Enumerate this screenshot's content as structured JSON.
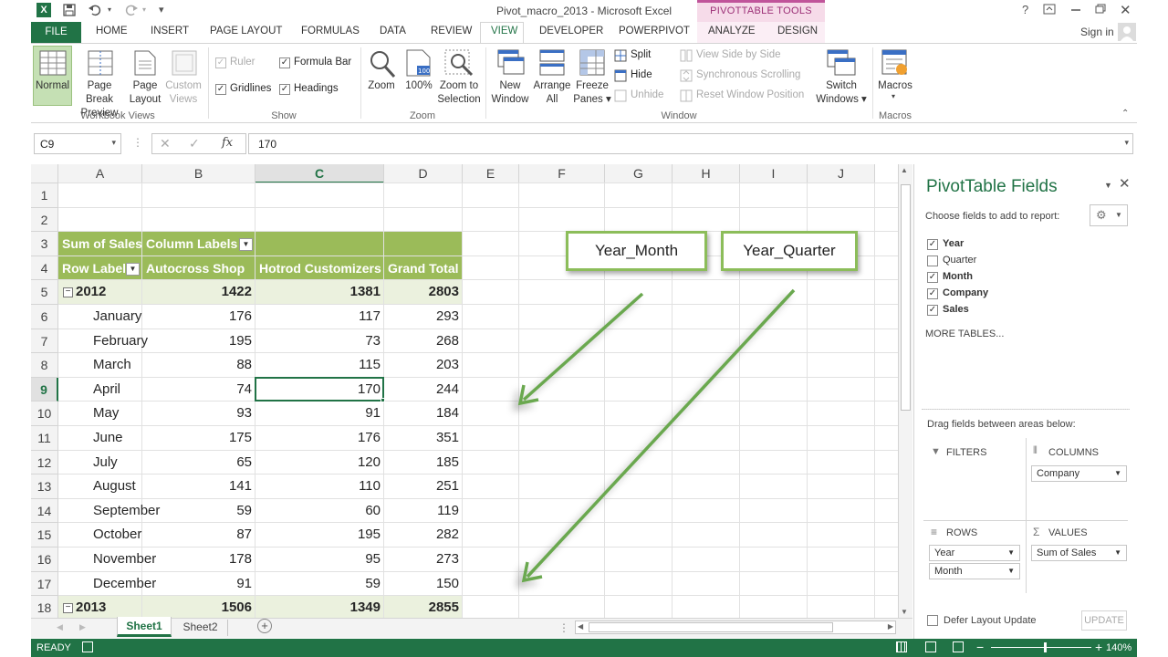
{
  "window": {
    "title": "Pivot_macro_2013 - Microsoft Excel",
    "context_tool": "PIVOTTABLE TOOLS",
    "sign_in": "Sign in",
    "help": "?",
    "buttons": [
      "restore-ribbon-icon",
      "minimize-icon",
      "maximize-icon",
      "close-icon"
    ]
  },
  "tabs": [
    "FILE",
    "HOME",
    "INSERT",
    "PAGE LAYOUT",
    "FORMULAS",
    "DATA",
    "REVIEW",
    "VIEW",
    "DEVELOPER",
    "POWERPIVOT",
    "ANALYZE",
    "DESIGN"
  ],
  "active_tab": "VIEW",
  "ribbon": {
    "workbook_views": {
      "group": "Workbook Views",
      "normal": "Normal",
      "page_break": [
        "Page Break",
        "Preview"
      ],
      "page_layout": [
        "Page",
        "Layout"
      ],
      "custom": [
        "Custom",
        "Views"
      ]
    },
    "show": {
      "group": "Show",
      "ruler": "Ruler",
      "formula_bar": "Formula Bar",
      "gridlines": "Gridlines",
      "headings": "Headings"
    },
    "zoom": {
      "group": "Zoom",
      "zoom": "Zoom",
      "hundred": "100%",
      "zoom_sel": [
        "Zoom to",
        "Selection"
      ]
    },
    "window": {
      "group": "Window",
      "new": [
        "New",
        "Window"
      ],
      "arrange": [
        "Arrange",
        "All"
      ],
      "freeze": [
        "Freeze",
        "Panes ▾"
      ],
      "split": "Split",
      "hide": "Hide",
      "unhide": "Unhide",
      "side": "View Side by Side",
      "sync": "Synchronous Scrolling",
      "reset": "Reset Window Position",
      "switch": [
        "Switch",
        "Windows ▾"
      ]
    },
    "macros": {
      "group": "Macros",
      "macros": "Macros"
    }
  },
  "formula_bar": {
    "name_box": "C9",
    "fx": "fx",
    "value": "170"
  },
  "columns": [
    "A",
    "B",
    "C",
    "D",
    "E",
    "F",
    "G",
    "H",
    "I",
    "J"
  ],
  "rows": [
    "1",
    "2",
    "3",
    "4",
    "5",
    "6",
    "7",
    "8",
    "9",
    "10",
    "11",
    "12",
    "13",
    "14",
    "15",
    "16",
    "17",
    "18"
  ],
  "pivot_table": {
    "header1_a": "Sum of Sales",
    "header1_b": "Column Labels",
    "header2": [
      "Row Labels",
      "Autocross Shop",
      "Hotrod Customizers",
      "Grand Total"
    ],
    "year_rows": [
      {
        "label": "2012",
        "values": [
          "1422",
          "1381",
          "2803"
        ]
      },
      {
        "label": "2013",
        "values": [
          "1506",
          "1349",
          "2855"
        ]
      }
    ],
    "months": [
      {
        "label": "January",
        "values": [
          "176",
          "117",
          "293"
        ]
      },
      {
        "label": "February",
        "values": [
          "195",
          "73",
          "268"
        ]
      },
      {
        "label": "March",
        "values": [
          "88",
          "115",
          "203"
        ]
      },
      {
        "label": "April",
        "values": [
          "74",
          "170",
          "244"
        ]
      },
      {
        "label": "May",
        "values": [
          "93",
          "91",
          "184"
        ]
      },
      {
        "label": "June",
        "values": [
          "175",
          "176",
          "351"
        ]
      },
      {
        "label": "July",
        "values": [
          "65",
          "120",
          "185"
        ]
      },
      {
        "label": "August",
        "values": [
          "141",
          "110",
          "251"
        ]
      },
      {
        "label": "September",
        "values": [
          "59",
          "60",
          "119"
        ]
      },
      {
        "label": "October",
        "values": [
          "87",
          "195",
          "282"
        ]
      },
      {
        "label": "November",
        "values": [
          "178",
          "95",
          "273"
        ]
      },
      {
        "label": "December",
        "values": [
          "91",
          "59",
          "150"
        ]
      }
    ]
  },
  "annotations": [
    "Year_Month",
    "Year_Quarter"
  ],
  "pivot_panel": {
    "title": "PivotTable Fields",
    "subtitle": "Choose fields to add to report:",
    "fields": [
      {
        "name": "Year",
        "checked": true
      },
      {
        "name": "Quarter",
        "checked": false
      },
      {
        "name": "Month",
        "checked": true
      },
      {
        "name": "Company",
        "checked": true
      },
      {
        "name": "Sales",
        "checked": true
      }
    ],
    "more_tables": "MORE TABLES...",
    "drag_hint": "Drag fields between areas below:",
    "filters": "FILTERS",
    "columns": "COLUMNS",
    "rows": "ROWS",
    "values": "VALUES",
    "columns_items": [
      "Company"
    ],
    "rows_items": [
      "Year",
      "Month"
    ],
    "values_items": [
      "Sum of Sales"
    ],
    "defer": "Defer Layout Update",
    "update": "UPDATE"
  },
  "sheets": [
    "Sheet1",
    "Sheet2"
  ],
  "active_sheet": "Sheet1",
  "status": {
    "ready": "READY",
    "zoom": "140%"
  },
  "colors": {
    "excel_green": "#217346",
    "pivot_header": "#9bbb59",
    "pivot_light": "#ebf1de",
    "annotation_border": "#8cbd5a",
    "arrow": "#6aa84f"
  }
}
